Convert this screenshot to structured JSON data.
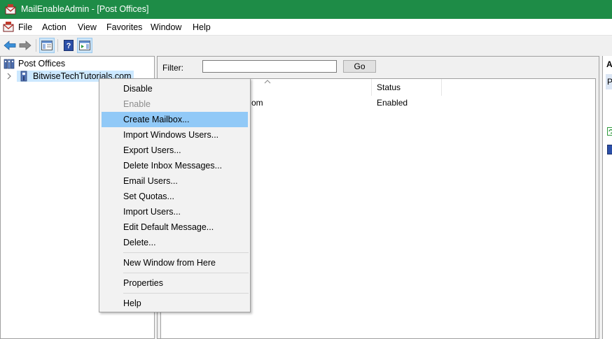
{
  "window": {
    "title": "MailEnableAdmin - [Post Offices]",
    "title_bar_color": "#1e8c47"
  },
  "menubar": {
    "items": [
      "File",
      "Action",
      "View",
      "Favorites",
      "Window",
      "Help"
    ]
  },
  "toolbar": {
    "buttons": [
      "back-icon",
      "forward-icon",
      "show-hide-tree-icon",
      "help-icon",
      "show-hide-action-pane-icon"
    ]
  },
  "tree": {
    "root_label": "Post Offices",
    "child_label": "BitwiseTechTutorials.com"
  },
  "filter": {
    "label": "Filter:",
    "value": "",
    "go_label": "Go"
  },
  "list": {
    "columns": [
      "",
      "Status"
    ],
    "rows": [
      {
        "name_fragment": "om",
        "status": "Enabled"
      }
    ]
  },
  "actions_pane": {
    "header_fragment": "A",
    "item_fragment": "P"
  },
  "context_menu": {
    "items": [
      {
        "label": "Disable",
        "enabled": true
      },
      {
        "label": "Enable",
        "enabled": false
      },
      {
        "label": "Create Mailbox...",
        "enabled": true,
        "highlighted": true
      },
      {
        "label": "Import Windows Users...",
        "enabled": true
      },
      {
        "label": "Export Users...",
        "enabled": true
      },
      {
        "label": "Delete Inbox Messages...",
        "enabled": true
      },
      {
        "label": "Email Users...",
        "enabled": true
      },
      {
        "label": "Set Quotas...",
        "enabled": true
      },
      {
        "label": "Import Users...",
        "enabled": true
      },
      {
        "label": "Edit Default Message...",
        "enabled": true
      },
      {
        "label": "Delete...",
        "enabled": true
      },
      {
        "label": "New Window from Here",
        "enabled": true
      },
      {
        "label": "Properties",
        "enabled": true
      },
      {
        "label": "Help",
        "enabled": true
      }
    ],
    "highlight_color": "#91c9f7"
  }
}
